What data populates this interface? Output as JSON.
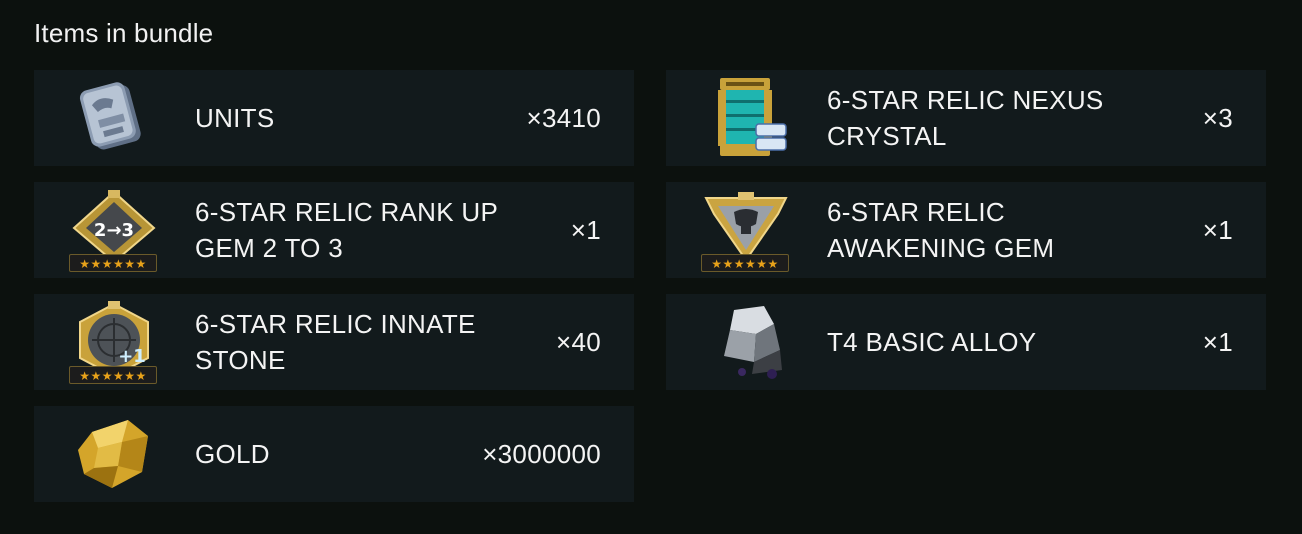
{
  "header": {
    "title": "Items in bundle"
  },
  "items": [
    {
      "name": "UNITS",
      "quantity": "×3410",
      "icon": "units-icon"
    },
    {
      "name": "6-STAR RELIC NEXUS CRYSTAL",
      "quantity": "×3",
      "icon": "nexus-crystal-icon"
    },
    {
      "name": "6-STAR RELIC RANK UP GEM 2 TO 3",
      "quantity": "×1",
      "icon": "rank-up-gem-icon",
      "icon_text": "2→3",
      "stars": "★★★★★★"
    },
    {
      "name": "6-STAR RELIC AWAKENING GEM",
      "quantity": "×1",
      "icon": "awakening-gem-icon",
      "stars": "★★★★★★"
    },
    {
      "name": "6-STAR RELIC INNATE STONE",
      "quantity": "×40",
      "icon": "innate-stone-icon",
      "icon_text": "+1",
      "stars": "★★★★★★"
    },
    {
      "name": "T4 BASIC ALLOY",
      "quantity": "×1",
      "icon": "alloy-icon"
    },
    {
      "name": "GOLD",
      "quantity": "×3000000",
      "icon": "gold-icon"
    }
  ],
  "colors": {
    "background": "#0c110e",
    "card": "#121a1c",
    "star": "#e8a21a",
    "gold": "#d4a52a"
  }
}
